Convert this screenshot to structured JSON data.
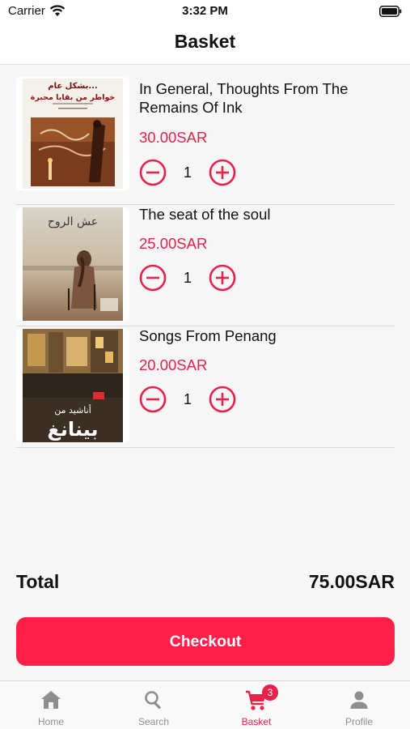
{
  "status_bar": {
    "carrier": "Carrier",
    "time": "3:32 PM"
  },
  "nav": {
    "title": "Basket"
  },
  "cart": {
    "items": [
      {
        "title": "In General, Thoughts From The Remains Of Ink",
        "price": "30.00SAR",
        "quantity": "1",
        "cover_text": [
          "بشكل عام...",
          "خواطر من بقايا محبرة"
        ]
      },
      {
        "title": "The seat of the soul",
        "price": "25.00SAR",
        "quantity": "1",
        "cover_text": [
          "عش الروح"
        ]
      },
      {
        "title": "Songs From Penang",
        "price": "20.00SAR",
        "quantity": "1",
        "cover_text": [
          "أناشيد من",
          "بينانغ"
        ]
      }
    ]
  },
  "total": {
    "label": "Total",
    "value": "75.00SAR"
  },
  "checkout": {
    "label": "Checkout"
  },
  "tabs": [
    {
      "label": "Home",
      "icon": "home-icon"
    },
    {
      "label": "Search",
      "icon": "search-icon"
    },
    {
      "label": "Basket",
      "icon": "cart-icon",
      "badge": "3",
      "active": true
    },
    {
      "label": "Profile",
      "icon": "profile-icon"
    }
  ],
  "colors": {
    "accent": "#e8224a",
    "checkout": "#ff1f48",
    "inactive_tab": "#8e8e8e"
  }
}
